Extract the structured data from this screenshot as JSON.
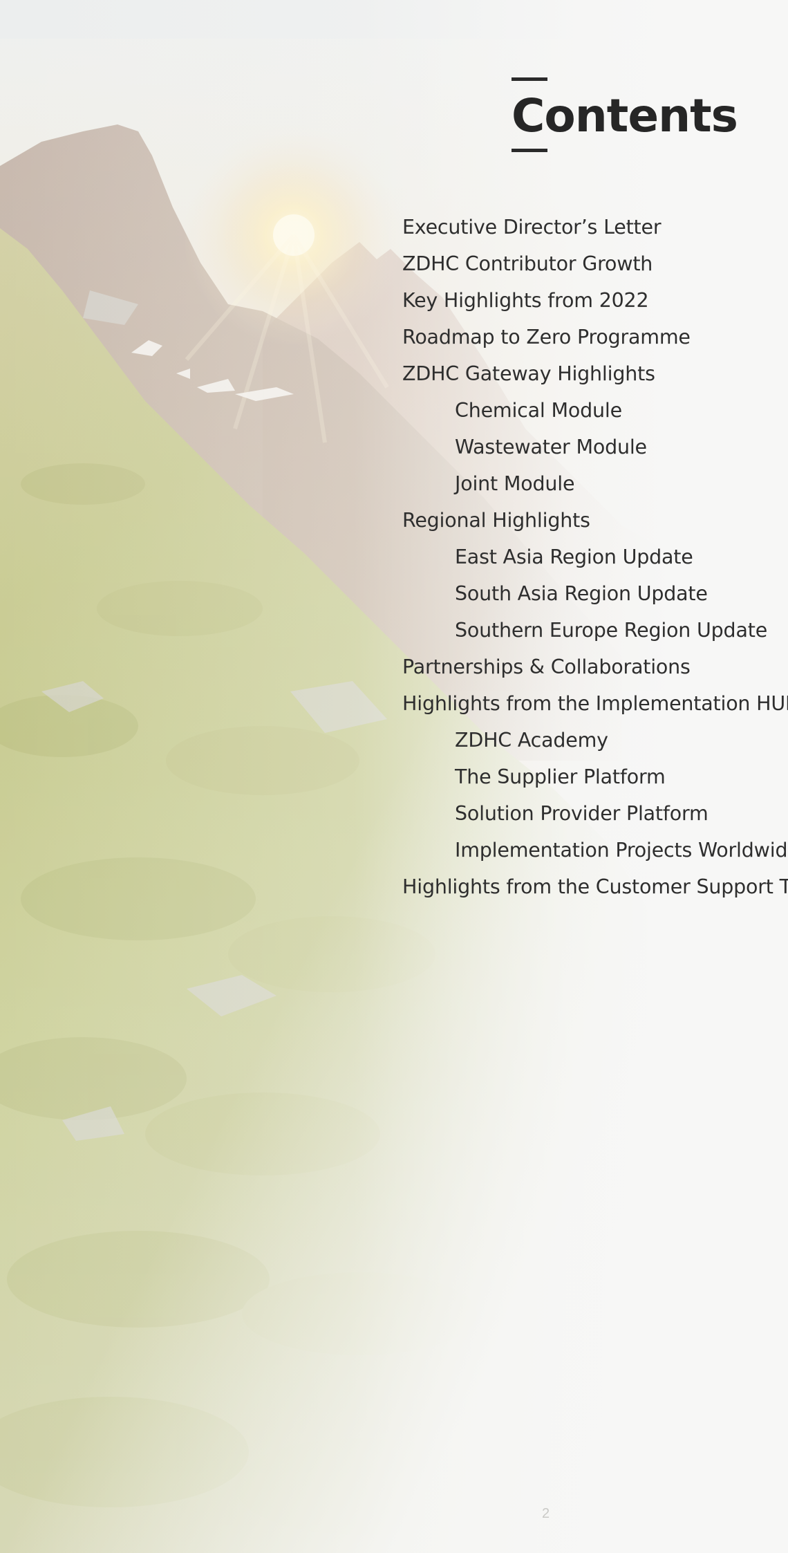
{
  "page": {
    "title": "Contents",
    "page_number": "2"
  },
  "toc": [
    {
      "label": "Executive Director’s Letter",
      "level": 1
    },
    {
      "label": "ZDHC Contributor Growth",
      "level": 1
    },
    {
      "label": "Key Highlights from 2022",
      "level": 1
    },
    {
      "label": "Roadmap to Zero Programme",
      "level": 1
    },
    {
      "label": "ZDHC Gateway Highlights",
      "level": 1
    },
    {
      "label": "Chemical Module",
      "level": 2
    },
    {
      "label": "Wastewater Module",
      "level": 2
    },
    {
      "label": "Joint Module",
      "level": 2
    },
    {
      "label": "Regional Highlights",
      "level": 1
    },
    {
      "label": "East Asia Region Update",
      "level": 2
    },
    {
      "label": "South Asia Region Update",
      "level": 2
    },
    {
      "label": "Southern Europe Region Update",
      "level": 2
    },
    {
      "label": "Partnerships & Collaborations",
      "level": 1
    },
    {
      "label": "Highlights from the Implementation HUB",
      "level": 1
    },
    {
      "label": "ZDHC Academy",
      "level": 2
    },
    {
      "label": "The Supplier Platform",
      "level": 2
    },
    {
      "label": "Solution Provider Platform",
      "level": 2
    },
    {
      "label": "Implementation Projects Worldwide",
      "level": 2
    },
    {
      "label": "Highlights from the Customer Support Team",
      "level": 1
    }
  ],
  "colors": {
    "text": "#2e2e2e",
    "title": "#262626",
    "background": "#f7f7f6"
  },
  "background_image": "mountain-sunrise-hillside"
}
